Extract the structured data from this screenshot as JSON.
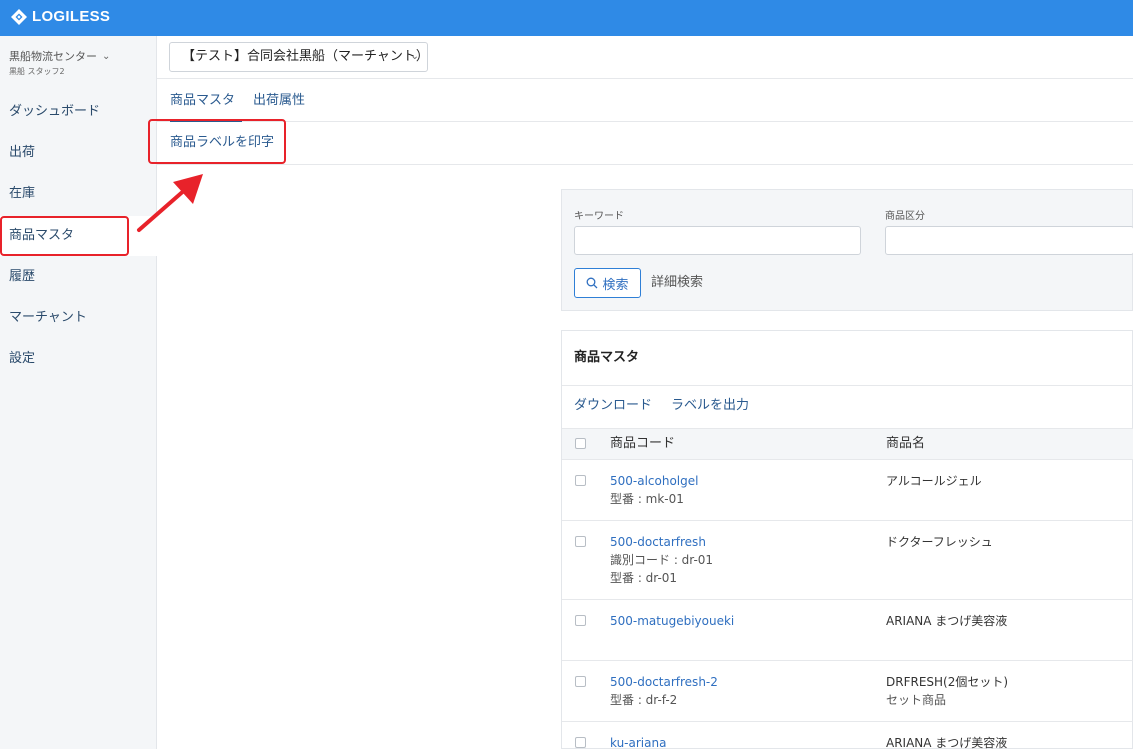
{
  "header": {
    "logo_text": "LOGILESS",
    "bg_color": "#2f8ae6"
  },
  "sidebar": {
    "center_name": "黒船物流センター",
    "staff_name": "黒船 スタッフ2",
    "items": [
      {
        "label": "ダッシュボード"
      },
      {
        "label": "出荷"
      },
      {
        "label": "在庫"
      },
      {
        "label": "商品マスタ",
        "active": true
      },
      {
        "label": "履歴"
      },
      {
        "label": "マーチャント"
      },
      {
        "label": "設定"
      }
    ]
  },
  "merchant_select": {
    "value": "【テスト】合同会社黒船（マーチャント）"
  },
  "tabs": [
    {
      "label": "商品マスタ",
      "active": true
    },
    {
      "label": "出荷属性"
    }
  ],
  "subaction": {
    "label": "商品ラベルを印字"
  },
  "search": {
    "keyword_label": "キーワード",
    "category_label": "商品区分",
    "search_button": "検索",
    "advanced_link": "詳細検索"
  },
  "list": {
    "title": "商品マスタ",
    "download": "ダウンロード",
    "label_output": "ラベルを出力",
    "col_code": "商品コード",
    "col_name": "商品名",
    "rows": [
      {
        "code": "500-alcoholgel",
        "sub1": "型番 : mk-01",
        "sub2": "",
        "name": "アルコールジェル",
        "note": ""
      },
      {
        "code": "500-doctarfresh",
        "sub1": "識別コード : dr-01",
        "sub2": "型番 : dr-01",
        "name": "ドクターフレッシュ",
        "note": ""
      },
      {
        "code": "500-matugebiyoueki",
        "sub1": "",
        "sub2": "",
        "name": "ARIANA まつげ美容液",
        "note": ""
      },
      {
        "code": "500-doctarfresh-2",
        "sub1": "型番 : dr-f-2",
        "sub2": "",
        "name": "DRFRESH(2個セット)",
        "note": "セット商品"
      },
      {
        "code": "ku-ariana",
        "sub1": "",
        "sub2": "",
        "name": "ARIANA まつげ美容液",
        "note": ""
      }
    ]
  }
}
